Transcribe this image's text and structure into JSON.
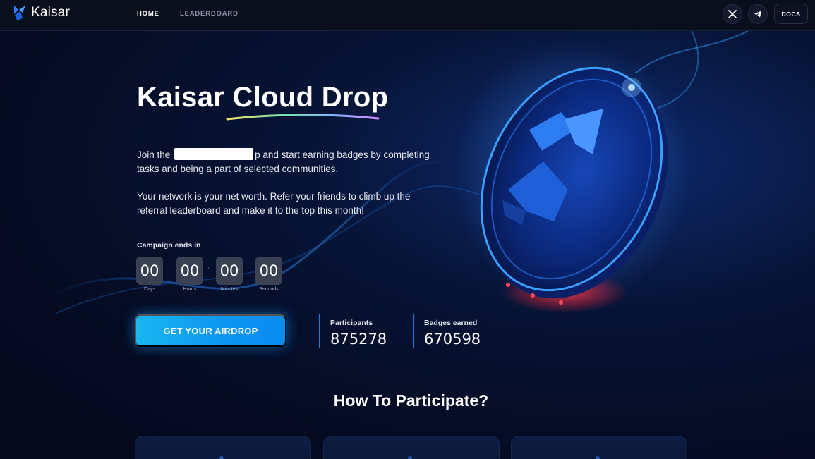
{
  "nav": {
    "brand": "Kaisar",
    "links": [
      {
        "label": "HOME",
        "active": true
      },
      {
        "label": "LEADERBOARD",
        "active": false
      }
    ],
    "social_icons": [
      "x-icon",
      "telegram-icon"
    ],
    "docs_label": "DOCS"
  },
  "hero": {
    "title": "Kaisar Cloud Drop",
    "paragraph1_start": "Join the",
    "paragraph1_end": "p and start earning badges by completing tasks and being a part of selected communities.",
    "paragraph2": "Your network is your net worth. Refer your friends to climb up the referral leaderboard and make it to the top this month!"
  },
  "countdown": {
    "label": "Campaign ends in",
    "units": [
      {
        "value": "00",
        "label": "Days"
      },
      {
        "value": "00",
        "label": "Hours"
      },
      {
        "value": "00",
        "label": "Minutes"
      },
      {
        "value": "00",
        "label": "Seconds"
      }
    ],
    "separator": ":"
  },
  "cta": {
    "label": "GET YOUR AIRDROP"
  },
  "stats": [
    {
      "label": "Participants",
      "value": "875278"
    },
    {
      "label": "Badges earned",
      "value": "670598"
    }
  ],
  "section": {
    "title": "How To Participate?"
  },
  "colors": {
    "accent": "#19b6f0",
    "background": "#050b22",
    "nav_background": "#0a0f1d",
    "timer_box": "#3a4152",
    "stat_divider": "#1e7be0"
  }
}
